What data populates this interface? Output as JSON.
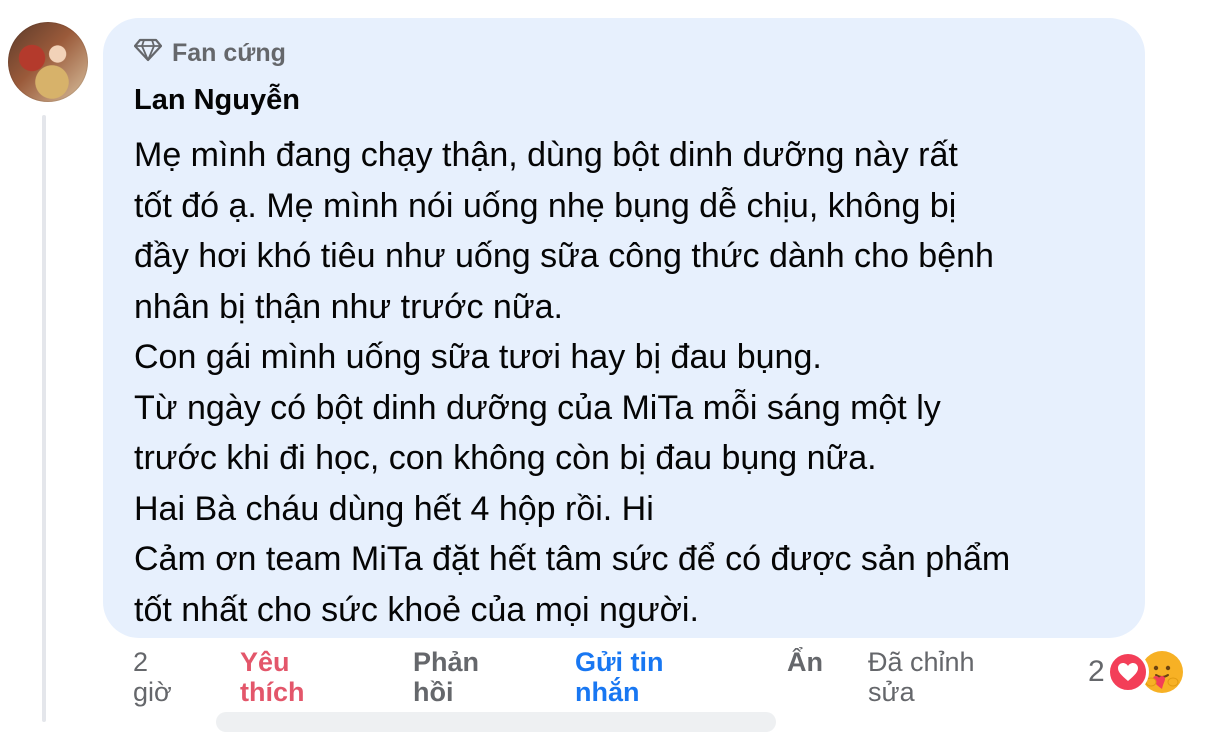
{
  "comment": {
    "badge": "Fan cứng",
    "author": "Lan Nguyễn",
    "lines": [
      "Mẹ mình đang chạy thận, dùng bột dinh dưỡng này rất",
      "tốt đó ạ. Mẹ mình nói uống nhẹ bụng dễ chịu, không bị",
      "đầy hơi khó tiêu như uống sữa công thức dành cho bệnh",
      "nhân bị thận như trước nữa.",
      "Con gái mình uống sữa tươi hay bị đau bụng.",
      "Từ ngày có bột dinh dưỡng của MiTa mỗi sáng một ly",
      "trước khi đi học, con không còn bị đau bụng nữa.",
      "Hai Bà cháu dùng hết 4 hộp rồi. Hi",
      "Cảm ơn team MiTa đặt hết tâm sức để có được sản phẩm",
      "tốt nhất cho sức khoẻ của mọi người."
    ]
  },
  "actions": {
    "time_line1": "2",
    "time_line2": "giờ",
    "like_line1": "Yêu",
    "like_line2": "thích",
    "reply_line1": "Phản",
    "reply_line2": "hồi",
    "message_line1": "Gửi tin",
    "message_line2": "nhắn",
    "hide": "Ẩn",
    "edited_line1": "Đã chỉnh",
    "edited_line2": "sửa"
  },
  "reactions": {
    "count": "2",
    "icons": [
      "heart-reaction-icon",
      "care-reaction-icon"
    ]
  },
  "colors": {
    "bubble": "#e7f0fd",
    "like": "#e3566a",
    "message": "#1877f2",
    "muted": "#65676b"
  }
}
